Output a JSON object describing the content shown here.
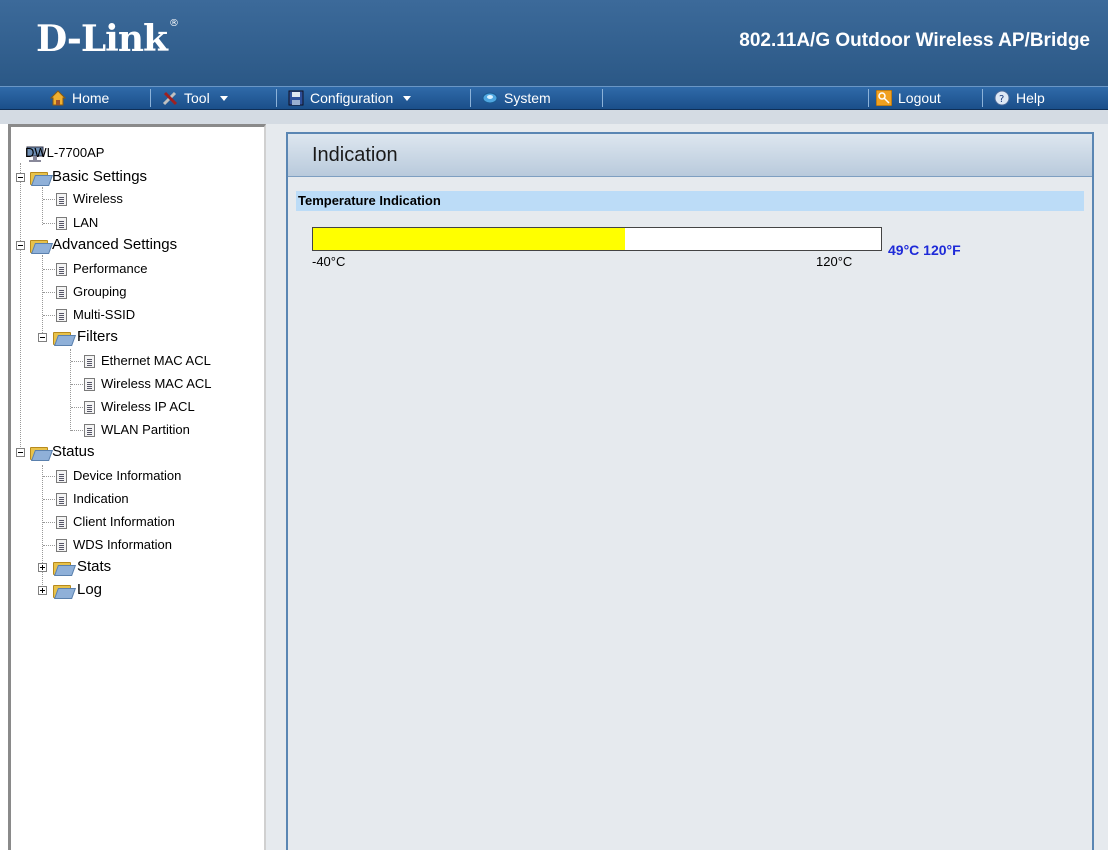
{
  "header": {
    "logo": "D-Link",
    "logo_mark": "®",
    "device_title": "802.11A/G Outdoor Wireless AP/Bridge"
  },
  "menu": {
    "home": "Home",
    "tool": "Tool",
    "configuration": "Configuration",
    "system": "System",
    "logout": "Logout",
    "help": "Help"
  },
  "sidebar": {
    "root": "DWL-7700AP",
    "basic_settings": "Basic Settings",
    "wireless": "Wireless",
    "lan": "LAN",
    "advanced_settings": "Advanced Settings",
    "performance": "Performance",
    "grouping": "Grouping",
    "multi_ssid": "Multi-SSID",
    "filters": "Filters",
    "ethernet_mac_acl": "Ethernet MAC ACL",
    "wireless_mac_acl": "Wireless MAC ACL",
    "wireless_ip_acl": "Wireless IP ACL",
    "wlan_partition": "WLAN Partition",
    "status": "Status",
    "device_information": "Device Information",
    "indication": "Indication",
    "client_information": "Client Information",
    "wds_information": "WDS Information",
    "stats": "Stats",
    "log": "Log"
  },
  "main": {
    "title": "Indication",
    "section": "Temperature Indication",
    "temperature": {
      "min_label": "-40°C",
      "max_label": "120°C",
      "reading": "49°C 120°F",
      "fill_fraction": 0.55,
      "fill_color": "#ffff00"
    }
  },
  "colors": {
    "header_bg": "#2b5886",
    "menu_bg": "#1b4f8a",
    "reading_text": "#1e2ad8",
    "section_bar": "#bcdcf7"
  }
}
